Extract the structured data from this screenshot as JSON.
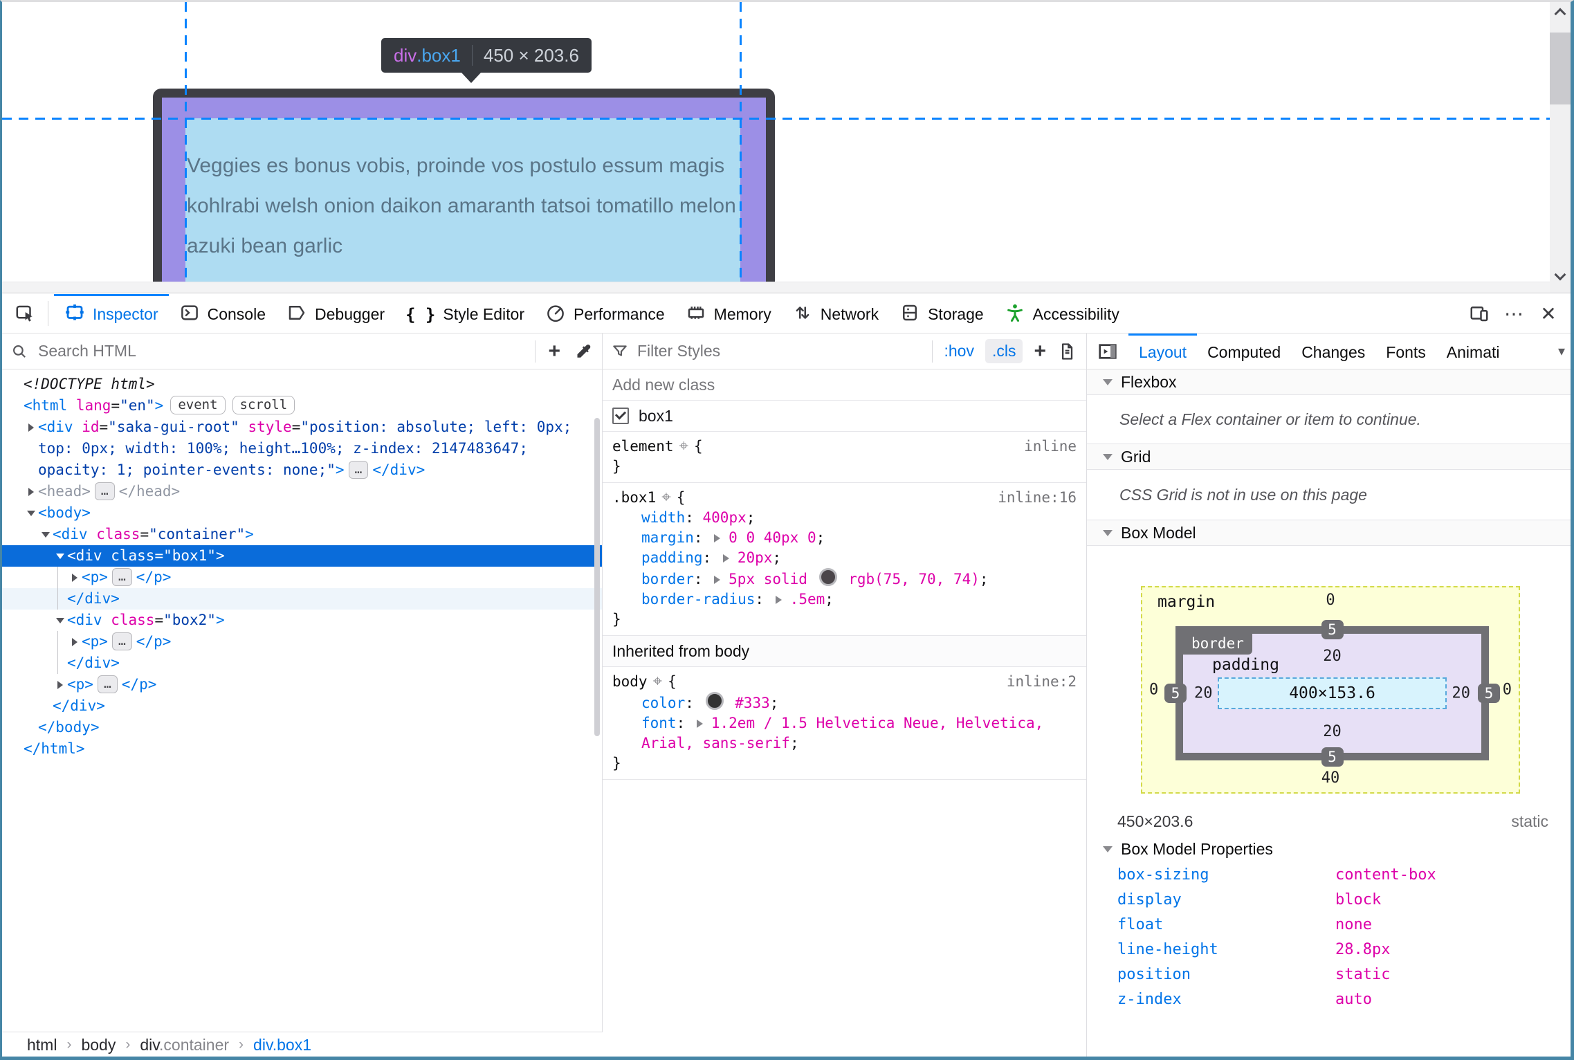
{
  "page": {
    "tooltip": {
      "tag": "div",
      "cls": ".box1",
      "dims": "450 × 203.6"
    },
    "box_text": "Veggies es bonus vobis, proinde vos postulo essum magis kohlrabi welsh onion daikon amaranth tatsoi tomatillo melon azuki bean garlic"
  },
  "toolbar": {
    "tabs": [
      {
        "label": "Inspector",
        "icon": "inspector",
        "active": true
      },
      {
        "label": "Console",
        "icon": "console"
      },
      {
        "label": "Debugger",
        "icon": "debugger"
      },
      {
        "label": "Style Editor",
        "icon": "style-editor"
      },
      {
        "label": "Performance",
        "icon": "performance"
      },
      {
        "label": "Memory",
        "icon": "memory"
      },
      {
        "label": "Network",
        "icon": "network"
      },
      {
        "label": "Storage",
        "icon": "storage"
      },
      {
        "label": "Accessibility",
        "icon": "accessibility"
      }
    ],
    "right_icons": [
      {
        "name": "responsive-design-icon",
        "glyph": ""
      },
      {
        "name": "menu-icon",
        "glyph": "⋯"
      },
      {
        "name": "close-icon",
        "glyph": "✕"
      }
    ]
  },
  "markup_toolbar": {
    "search_placeholder": "Search HTML",
    "add_node": "+"
  },
  "rules_toolbar": {
    "filter_placeholder": "Filter Styles",
    "pseudo": ":hov",
    "cls": ".cls",
    "add": "+"
  },
  "sidebar_tabs": {
    "tabs": [
      {
        "label": "Layout",
        "active": true
      },
      {
        "label": "Computed"
      },
      {
        "label": "Changes"
      },
      {
        "label": "Fonts"
      },
      {
        "label": "Animati"
      }
    ],
    "overflow": "▾"
  },
  "markup": {
    "rows": [
      {
        "i": 0,
        "segs": [
          {
            "t": "<!DOCTYPE html>",
            "c": "doctype"
          }
        ]
      },
      {
        "i": 0,
        "segs": [
          {
            "t": "<html",
            "c": "tag"
          },
          {
            "t": " lang",
            "c": "attr"
          },
          {
            "t": "=",
            "c": "plain"
          },
          {
            "t": "\"en\"",
            "c": "val"
          },
          {
            "t": ">",
            "c": "tag"
          },
          {
            "t": "event",
            "c": "badge"
          },
          {
            "t": "scroll",
            "c": "badge"
          }
        ]
      },
      {
        "i": 1,
        "a": "r",
        "segs": [
          {
            "t": "<div",
            "c": "tag"
          },
          {
            "t": " id",
            "c": "attr"
          },
          {
            "t": "=",
            "c": "plain"
          },
          {
            "t": "\"saka-gui-root\"",
            "c": "val"
          },
          {
            "t": " style",
            "c": "attr"
          },
          {
            "t": "=",
            "c": "plain"
          },
          {
            "t": "\"position: absolute; left: 0px; top: 0px; width: 100%; height…100%; z-index: 2147483647; opacity: 1; pointer-events: none;\"",
            "c": "val"
          },
          {
            "t": ">",
            "c": "tag"
          },
          {
            "t": "…",
            "c": "pill"
          },
          {
            "t": "</div>",
            "c": "tag"
          }
        ]
      },
      {
        "i": 1,
        "a": "r",
        "segs": [
          {
            "t": "<head>",
            "c": "muted"
          },
          {
            "t": "…",
            "c": "pill"
          },
          {
            "t": "</head>",
            "c": "muted"
          }
        ]
      },
      {
        "i": 1,
        "a": "d",
        "segs": [
          {
            "t": "<body>",
            "c": "tag"
          }
        ]
      },
      {
        "i": 2,
        "a": "d",
        "segs": [
          {
            "t": "<div",
            "c": "tag"
          },
          {
            "t": " class",
            "c": "attr"
          },
          {
            "t": "=",
            "c": "plain"
          },
          {
            "t": "\"container\"",
            "c": "val"
          },
          {
            "t": ">",
            "c": "tag"
          }
        ]
      },
      {
        "i": 3,
        "a": "d",
        "sel": true,
        "segs": [
          {
            "t": "<div",
            "c": "tag"
          },
          {
            "t": " class",
            "c": "attr"
          },
          {
            "t": "=",
            "c": "plain"
          },
          {
            "t": "\"box1\"",
            "c": "val"
          },
          {
            "t": ">",
            "c": "tag"
          }
        ]
      },
      {
        "i": 4,
        "a": "r",
        "guide": true,
        "segs": [
          {
            "t": "<p>",
            "c": "tag"
          },
          {
            "t": "…",
            "c": "pill"
          },
          {
            "t": "</p>",
            "c": "tag"
          }
        ]
      },
      {
        "i": 3,
        "hover": true,
        "guide": true,
        "segs": [
          {
            "t": "</div>",
            "c": "tag"
          }
        ]
      },
      {
        "i": 3,
        "a": "d",
        "segs": [
          {
            "t": "<div",
            "c": "tag"
          },
          {
            "t": " class",
            "c": "attr"
          },
          {
            "t": "=",
            "c": "plain"
          },
          {
            "t": "\"box2\"",
            "c": "val"
          },
          {
            "t": ">",
            "c": "tag"
          }
        ]
      },
      {
        "i": 4,
        "a": "r",
        "guide": true,
        "segs": [
          {
            "t": "<p>",
            "c": "tag"
          },
          {
            "t": "…",
            "c": "pill"
          },
          {
            "t": "</p>",
            "c": "tag"
          }
        ]
      },
      {
        "i": 3,
        "guide": true,
        "segs": [
          {
            "t": "</div>",
            "c": "tag"
          }
        ]
      },
      {
        "i": 3,
        "a": "r",
        "segs": [
          {
            "t": "<p>",
            "c": "tag"
          },
          {
            "t": "…",
            "c": "pill"
          },
          {
            "t": "</p>",
            "c": "tag"
          }
        ]
      },
      {
        "i": 2,
        "segs": [
          {
            "t": "</div>",
            "c": "tag"
          }
        ]
      },
      {
        "i": 1,
        "segs": [
          {
            "t": "</body>",
            "c": "tag"
          }
        ]
      },
      {
        "i": 0,
        "segs": [
          {
            "t": "</html>",
            "c": "tag"
          }
        ]
      }
    ]
  },
  "rules": {
    "sections": [
      {
        "type": "newclass",
        "text": "Add new class"
      },
      {
        "type": "classes",
        "items": [
          {
            "checked": true,
            "label": "box1"
          }
        ]
      },
      {
        "type": "rule",
        "selector": "element",
        "location": "inline",
        "props": []
      },
      {
        "type": "rule",
        "selector": ".box1",
        "location": "inline:16",
        "props": [
          {
            "name": "width",
            "segs": [
              {
                "t": "400px",
                "c": "v"
              }
            ]
          },
          {
            "name": "margin",
            "arrow": true,
            "segs": [
              {
                "t": "0 0 40px 0",
                "c": "v"
              }
            ]
          },
          {
            "name": "padding",
            "arrow": true,
            "segs": [
              {
                "t": "20px",
                "c": "v"
              }
            ]
          },
          {
            "name": "border",
            "arrow": true,
            "segs": [
              {
                "t": "5px solid ",
                "c": "v"
              },
              {
                "c": "swatch",
                "color": "#4b464a"
              },
              {
                "t": " rgb(75, 70, 74)",
                "c": "v"
              }
            ]
          },
          {
            "name": "border-radius",
            "arrow": true,
            "segs": [
              {
                "t": ".5em",
                "c": "v"
              }
            ]
          }
        ]
      },
      {
        "type": "header",
        "text": "Inherited from body"
      },
      {
        "type": "rule",
        "selector": "body",
        "location": "inline:2",
        "props": [
          {
            "name": "color",
            "segs": [
              {
                "c": "swatch",
                "color": "#333333"
              },
              {
                "t": " #333",
                "c": "v"
              }
            ]
          },
          {
            "name": "font",
            "arrow": true,
            "segs": [
              {
                "t": "1.2em / 1.5 Helvetica Neue, Helvetica, Arial, sans-serif",
                "c": "v"
              }
            ]
          }
        ]
      }
    ],
    "open_brace": "{",
    "close_brace": "}"
  },
  "layout": {
    "flexbox": {
      "title": "Flexbox",
      "message": "Select a Flex container or item to continue."
    },
    "grid": {
      "title": "Grid",
      "message": "CSS Grid is not in use on this page"
    },
    "box_model_title": "Box Model",
    "box_model": {
      "margin_label": "margin",
      "border_label": "border",
      "padding_label": "padding",
      "margin": {
        "top": "0",
        "right": "0",
        "bottom": "40",
        "left": "0"
      },
      "border": {
        "top": "5",
        "right": "5",
        "bottom": "5",
        "left": "5"
      },
      "padding": {
        "top": "20",
        "right": "20",
        "bottom": "20",
        "left": "20"
      },
      "content": "400×153.6",
      "dims": "450×203.6",
      "position": "static"
    },
    "box_model_properties": {
      "title": "Box Model Properties",
      "rows": [
        {
          "name": "box-sizing",
          "value": "content-box"
        },
        {
          "name": "display",
          "value": "block"
        },
        {
          "name": "float",
          "value": "none"
        },
        {
          "name": "line-height",
          "value": "28.8px"
        },
        {
          "name": "position",
          "value": "static"
        },
        {
          "name": "z-index",
          "value": "auto"
        }
      ]
    }
  },
  "breadcrumb": {
    "separator": "›",
    "items": [
      {
        "segs": [
          {
            "t": "html",
            "c": "bc-dark"
          }
        ]
      },
      {
        "segs": [
          {
            "t": "body",
            "c": "bc-dark"
          }
        ]
      },
      {
        "segs": [
          {
            "t": "div",
            "c": "bc-dark"
          },
          {
            "t": ".container",
            "c": "bc-gray"
          }
        ]
      },
      {
        "segs": [
          {
            "t": "div.box1",
            "c": "bc-blue"
          }
        ]
      }
    ]
  }
}
